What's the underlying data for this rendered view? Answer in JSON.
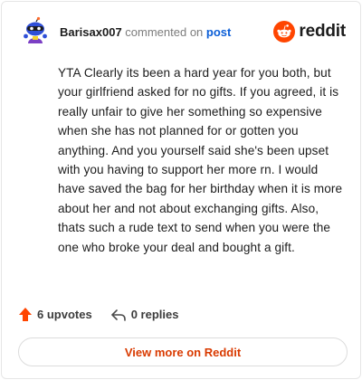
{
  "header": {
    "username": "Barisax007",
    "commented_text": "commented on",
    "post_link": "post",
    "brand": "reddit"
  },
  "comment": {
    "body": "YTA Clearly its been a hard year for you both, but your girlfriend asked for no gifts. If you agreed, it is really unfair to give her something so expensive when she has not planned for or gotten you anything. And you yourself said she's been upset with you having to support her more rn. I would have saved the bag for her birthday when it is more about her and not about exchanging gifts. Also, thats such a rude text to send when you were the one who broke your deal and bought a gift."
  },
  "actions": {
    "upvotes": "6 upvotes",
    "replies": "0 replies"
  },
  "footer": {
    "view_more": "View more on Reddit"
  },
  "colors": {
    "reddit_orange": "#ff4500",
    "link_blue": "#0b5ed7",
    "view_more": "#d93a00"
  },
  "icons": {
    "avatar": "snoo-avatar-icon",
    "brand": "reddit-logo-icon",
    "upvote": "upvote-arrow-icon",
    "reply": "reply-arrow-icon"
  }
}
